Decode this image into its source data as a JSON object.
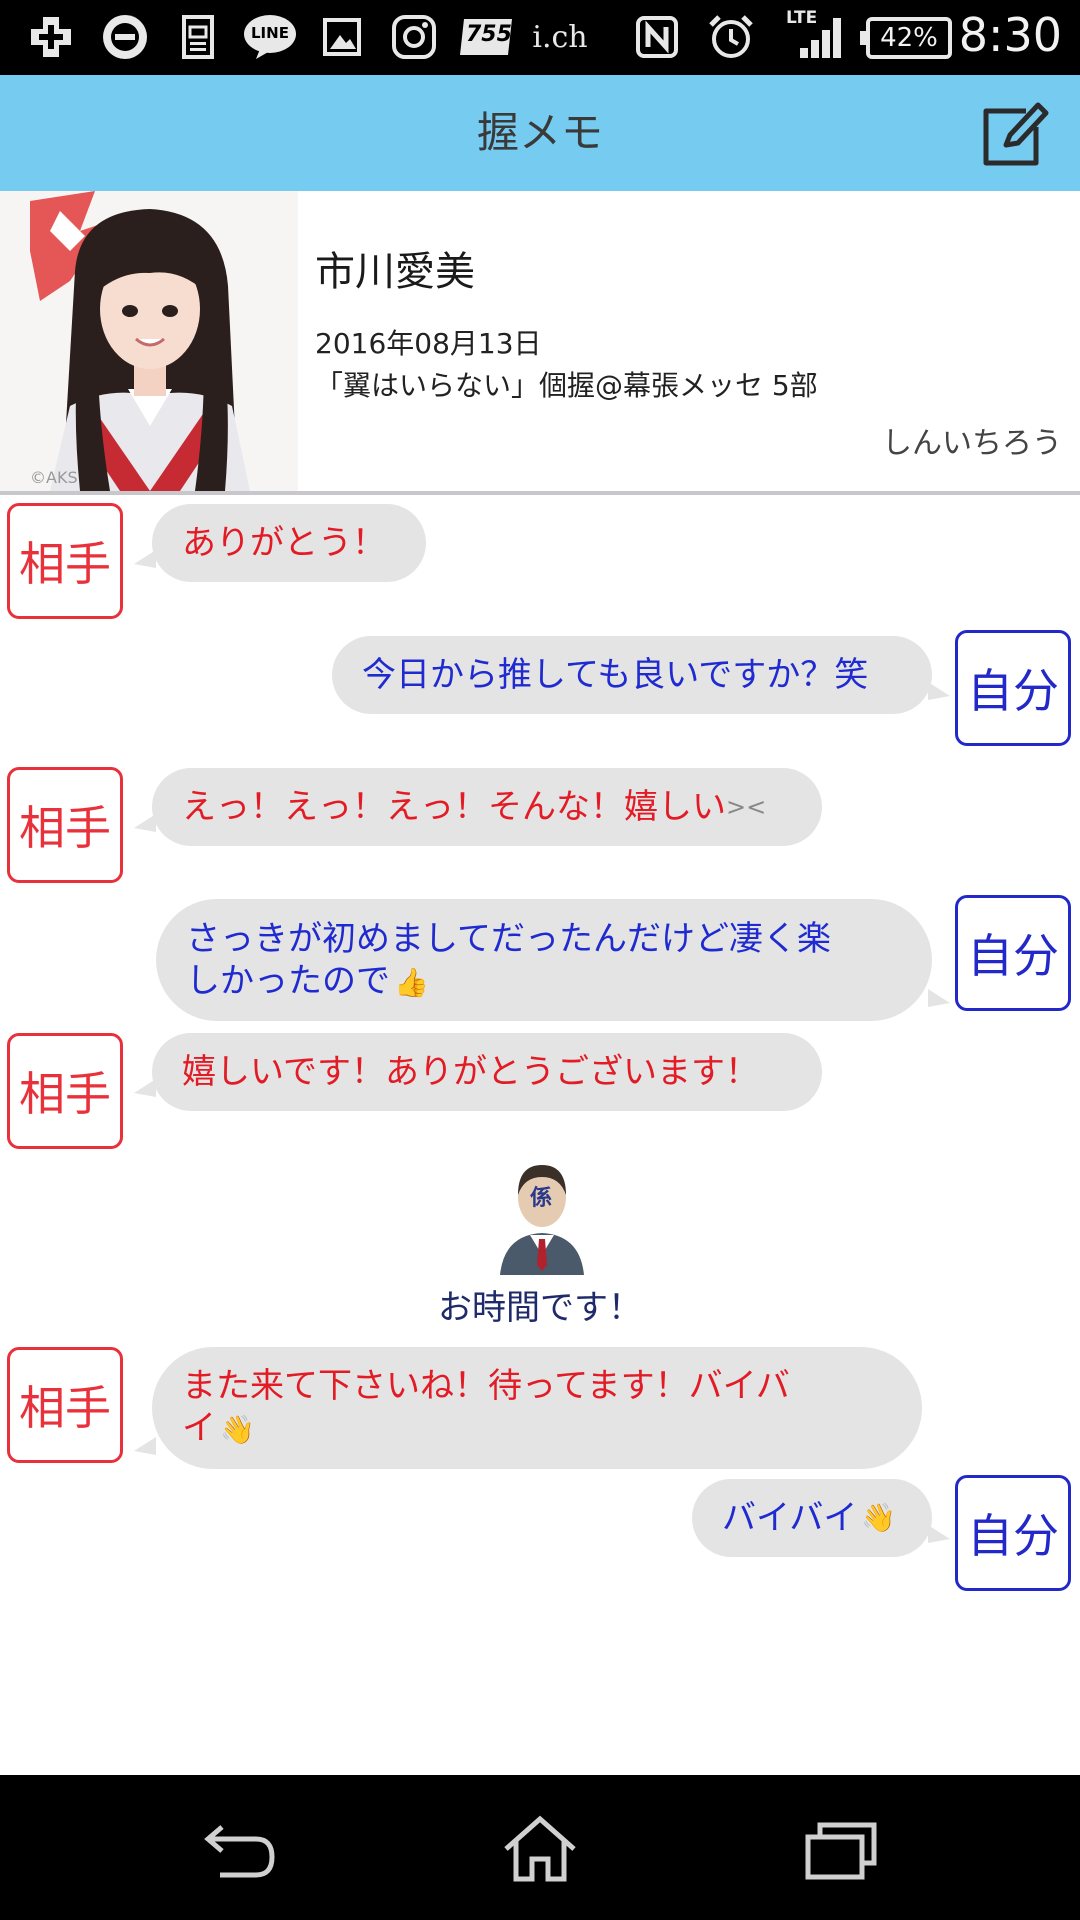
{
  "status_bar": {
    "time": "8:30",
    "battery": "42%",
    "network": "LTE",
    "icons": [
      "add-icon",
      "showroom-icon",
      "clipboard-icon",
      "line-icon",
      "image-icon",
      "instagram-icon",
      "755-icon",
      "ich-icon",
      "nfc-icon",
      "alarm-icon",
      "signal-icon",
      "battery-icon"
    ],
    "line_label": "LINE",
    "app755_label": "755",
    "ich_label": "i.ch"
  },
  "header": {
    "title": "握メモ",
    "edit_icon": "edit-icon"
  },
  "profile": {
    "name": "市川愛美",
    "date": "2016年08月13日",
    "event": "「翼はいらない」個握@幕張メッセ 5部",
    "user": "しんいちろう",
    "photo_credit": "©AKS"
  },
  "labels": {
    "them": "相手",
    "me": "自分"
  },
  "messages": [
    {
      "from": "them",
      "text": "ありがとう！"
    },
    {
      "from": "me",
      "text": "今日から推しても良いですか？笑"
    },
    {
      "from": "them",
      "text": "えっ！えっ！えっ！そんな！嬉しい",
      "emoji": "crying-emoji"
    },
    {
      "from": "me",
      "text_line1": "さっきが初めましてだったんだけど凄く楽",
      "text_line2": "しかったので",
      "emoji": "thumbs-up-emoji"
    },
    {
      "from": "them",
      "text": "嬉しいです！ありがとうございます！"
    },
    {
      "from": "them",
      "text_line1": "また来て下さいね！待ってます！バイバ",
      "text_line2": "イ",
      "emoji": "waving-hands-emoji"
    },
    {
      "from": "me",
      "text": "バイバイ",
      "emoji": "waving-hands-emoji"
    }
  ],
  "staff": {
    "badge": "係",
    "text": "お時間です！"
  },
  "colors": {
    "header_bg": "#76cbf1",
    "them": "#e8313a",
    "me": "#2229c8",
    "bubble_bg": "#e4e4e4",
    "staff_text": "#1f2a6a"
  },
  "nav": {
    "icons": [
      "back-icon",
      "home-icon",
      "recent-apps-icon"
    ]
  }
}
